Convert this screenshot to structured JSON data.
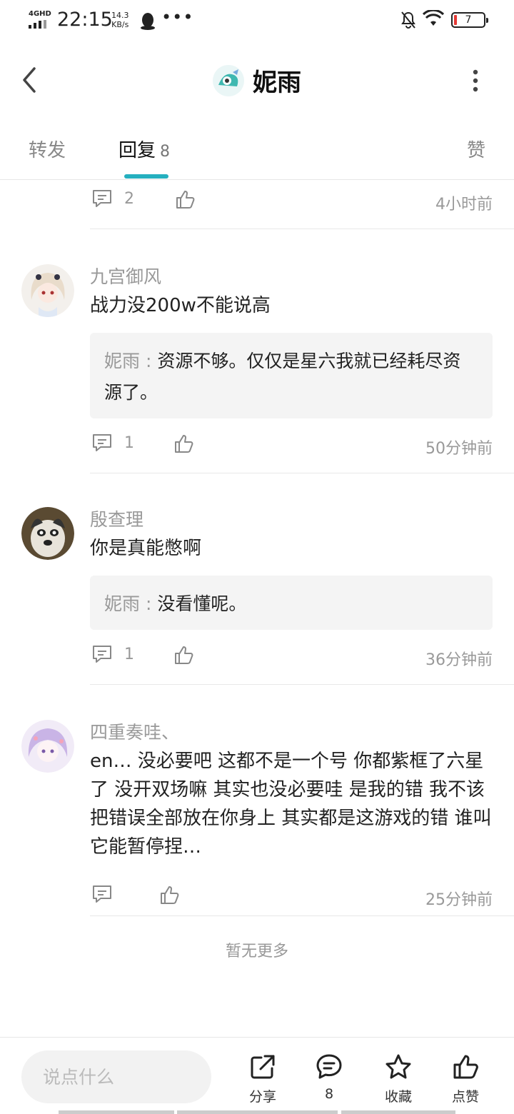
{
  "status_bar": {
    "network": "4GHD",
    "time": "22:15",
    "speed_value": "14.3",
    "speed_unit": "KB/s",
    "dots": "•••",
    "battery": "7",
    "colors": {
      "battery_low": "#e53935"
    }
  },
  "header": {
    "title": "妮雨",
    "back_icon": "chevron-left-icon",
    "more_icon": "more-vertical-icon"
  },
  "tabs": {
    "repost": "转发",
    "reply": "回复",
    "reply_count": "8",
    "like": "赞",
    "accent": "#25b0bf"
  },
  "comments": [
    {
      "reply_count": "2",
      "time": "4小时前"
    },
    {
      "user": "九宫御风",
      "text": "战力没200w不能说高",
      "quote_user": "妮雨",
      "quote_sep": " : ",
      "quote_text": "资源不够。仅仅是星六我就已经耗尽资源了。",
      "reply_count": "1",
      "time": "50分钟前"
    },
    {
      "user": "殷查理",
      "text": "你是真能憋啊",
      "quote_user": "妮雨",
      "quote_sep": " : ",
      "quote_text": "没看懂呢。",
      "reply_count": "1",
      "time": "36分钟前"
    },
    {
      "user": "四重奏哇、",
      "text": "en… 没必要吧 这都不是一个号 你都紫框了六星了 没开双场嘛 其实也没必要哇 是我的错 我不该把错误全部放在你身上 其实都是这游戏的错 谁叫它能暂停捏…",
      "time": "25分钟前"
    }
  ],
  "footer_note": "暂无更多",
  "bottom_bar": {
    "input_placeholder": "说点什么",
    "share": "分享",
    "comments_count": "8",
    "favorite": "收藏",
    "like": "点赞"
  }
}
